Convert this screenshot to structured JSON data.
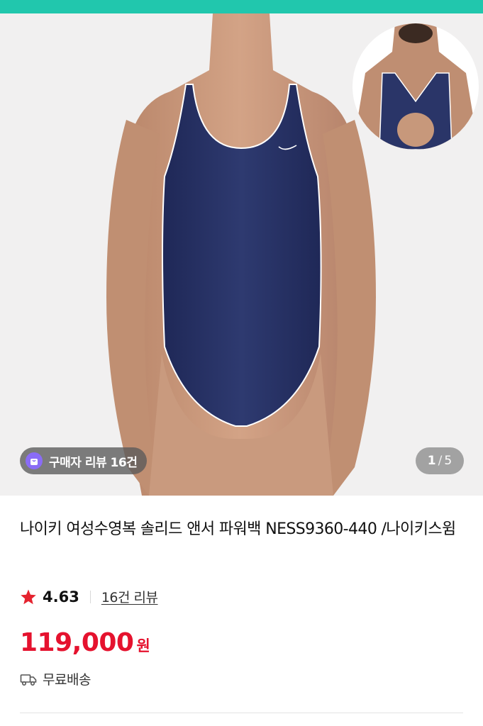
{
  "product": {
    "title": "나이키 여성수영복 솔리드 앤서 파워백 NESS9360-440 /나이키스윔",
    "rating": "4.63",
    "review_link": "16건 리뷰",
    "price": "119,000",
    "price_unit": "원",
    "shipping": "무료배송"
  },
  "gallery": {
    "review_chip": "구매자 리뷰 16건",
    "page_current": "1",
    "page_sep": "/",
    "page_total": "5",
    "swimsuit_color": "#2a3568",
    "background_color": "#f1f0f0"
  },
  "colors": {
    "accent_bar": "#21c7ad",
    "price_red": "#e5122e",
    "star_red": "#e5232f",
    "chip_purple": "#8a6cf6"
  },
  "icons": [
    "shopping-bag-icon",
    "star-icon",
    "truck-icon",
    "nike-swoosh-icon"
  ]
}
